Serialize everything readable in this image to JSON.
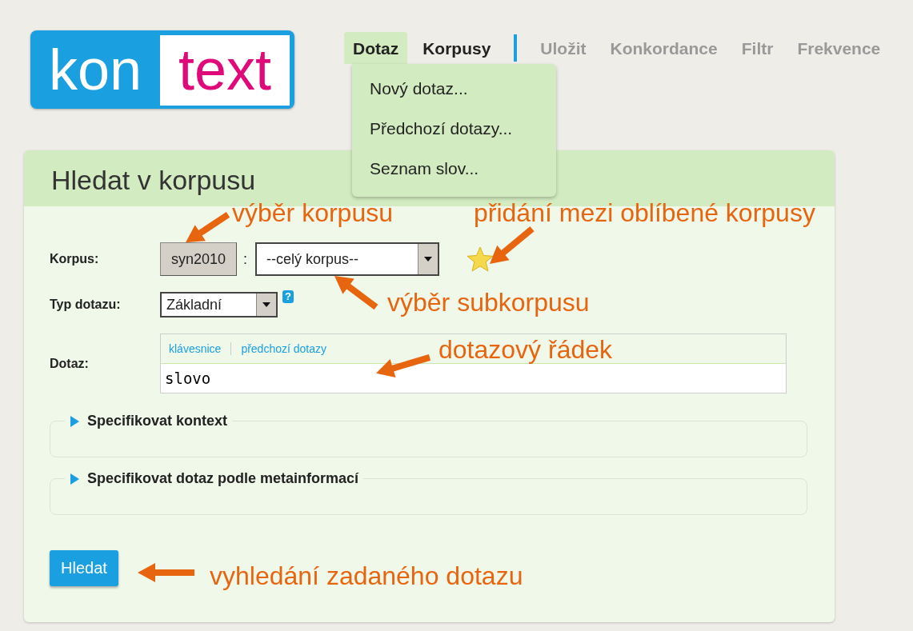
{
  "logo": {
    "part_1": "kon",
    "part_2": "text"
  },
  "nav": {
    "tabs": [
      {
        "label": "Dotaz",
        "selected": true,
        "disabled": false
      },
      {
        "label": "Korpusy",
        "selected": false,
        "disabled": false
      },
      {
        "label": "Uložit",
        "selected": false,
        "disabled": true
      },
      {
        "label": "Konkordance",
        "selected": false,
        "disabled": true
      },
      {
        "label": "Filtr",
        "selected": false,
        "disabled": true
      },
      {
        "label": "Frekvence",
        "selected": false,
        "disabled": true
      }
    ]
  },
  "menu": {
    "items": [
      "Nový dotaz...",
      "Předchozí dotazy...",
      "Seznam slov..."
    ]
  },
  "panel": {
    "title": "Hledat v korpusu",
    "corpus": {
      "label": "Korpus:",
      "button": "syn2010",
      "separator": ":",
      "subcorpus": "--celý korpus--"
    },
    "query_type": {
      "label": "Typ dotazu:",
      "value": "Základní",
      "help": "?"
    },
    "query": {
      "label": "Dotaz:",
      "links": [
        "klávesnice",
        "předchozí dotazy"
      ],
      "value": "slovo"
    },
    "sections": [
      {
        "title": "Specifikovat kontext",
        "expanded": false
      },
      {
        "title": "Specifikovat dotaz podle metainformací",
        "expanded": false
      }
    ],
    "submit": "Hledat"
  },
  "annotations": [
    {
      "text": "výběr korpusu"
    },
    {
      "text": "přidání mezi oblíbené korpusy"
    },
    {
      "text": "výběr subkorpusu"
    },
    {
      "text": "dotazový řádek"
    },
    {
      "text": "vyhledání zadaného dotazu"
    }
  ]
}
